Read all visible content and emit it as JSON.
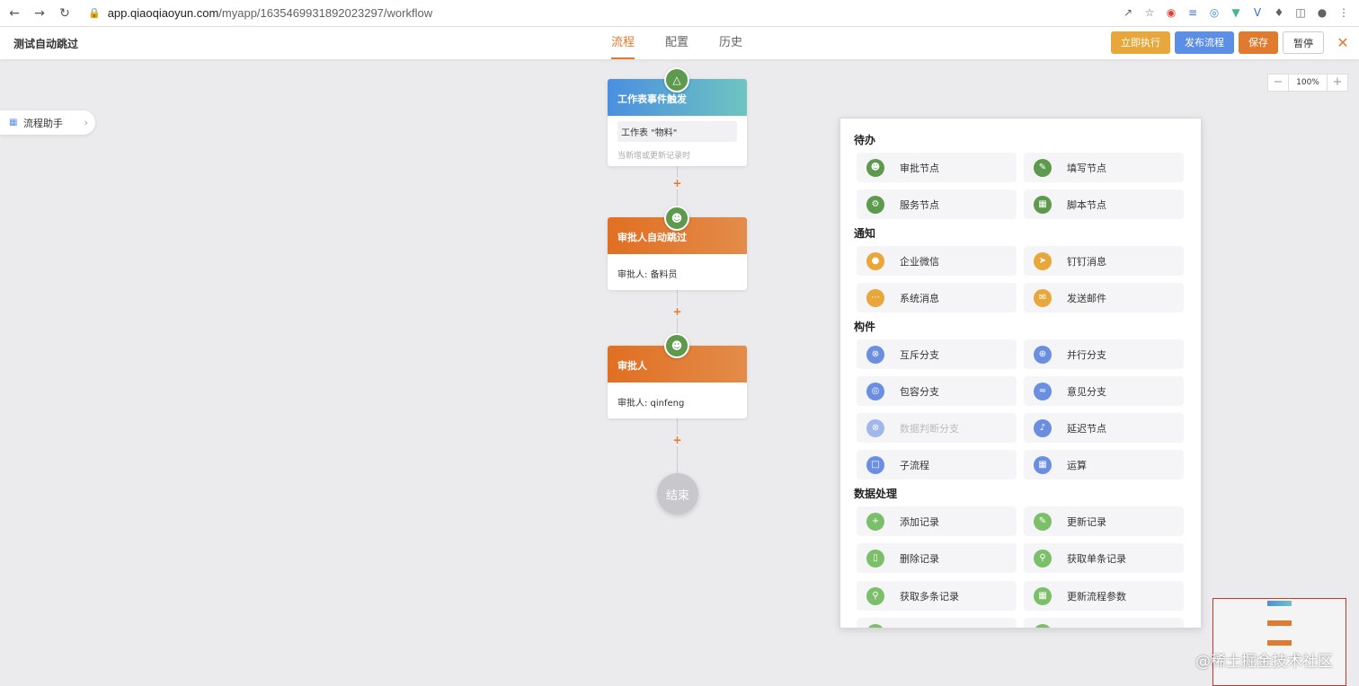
{
  "browser": {
    "url_host": "app.qiaoqiaoyun.com",
    "url_path": "/myapp/1635469931892023297/workflow"
  },
  "header": {
    "title": "测试自动跳过",
    "tabs": [
      {
        "label": "流程",
        "active": true
      },
      {
        "label": "配置",
        "active": false
      },
      {
        "label": "历史",
        "active": false
      }
    ],
    "run_label": "立即执行",
    "publish_label": "发布流程",
    "save_label": "保存",
    "pause_label": "暂停",
    "close_icon": "close-icon"
  },
  "helper": {
    "label": "流程助手"
  },
  "zoom": {
    "minus": "−",
    "value": "100%",
    "plus": "+"
  },
  "flow": {
    "trigger": {
      "title": "工作表事件触发",
      "table": "工作表 \"物料\"",
      "condition": "当新增或更新记录时"
    },
    "approver_auto": {
      "title": "审批人自动跳过",
      "detail": "审批人: 备料员"
    },
    "approver": {
      "title": "审批人",
      "detail": "审批人: qinfeng"
    },
    "end_label": "结束",
    "add_symbol": "+"
  },
  "panel": {
    "sections": [
      {
        "title": "待办",
        "items": [
          {
            "label": "审批节点",
            "icon": "user-icon",
            "color": "green"
          },
          {
            "label": "填写节点",
            "icon": "edit-icon",
            "color": "green"
          },
          {
            "label": "服务节点",
            "icon": "gear-icon",
            "color": "green"
          },
          {
            "label": "脚本节点",
            "icon": "script-icon",
            "color": "green"
          }
        ]
      },
      {
        "title": "通知",
        "items": [
          {
            "label": "企业微信",
            "icon": "wechat-icon",
            "color": "orange"
          },
          {
            "label": "钉钉消息",
            "icon": "dingtalk-icon",
            "color": "orange"
          },
          {
            "label": "系统消息",
            "icon": "message-icon",
            "color": "orange"
          },
          {
            "label": "发送邮件",
            "icon": "mail-icon",
            "color": "orange"
          }
        ]
      },
      {
        "title": "构件",
        "items": [
          {
            "label": "互斥分支",
            "icon": "exclusive-branch-icon",
            "color": "blue"
          },
          {
            "label": "并行分支",
            "icon": "parallel-branch-icon",
            "color": "blue"
          },
          {
            "label": "包容分支",
            "icon": "inclusive-branch-icon",
            "color": "blue"
          },
          {
            "label": "意见分支",
            "icon": "share-icon",
            "color": "blue"
          },
          {
            "label": "数据判断分支",
            "icon": "data-branch-icon",
            "color": "blue",
            "disabled": true
          },
          {
            "label": "延迟节点",
            "icon": "bell-icon",
            "color": "blue"
          },
          {
            "label": "子流程",
            "icon": "subprocess-icon",
            "color": "blue"
          },
          {
            "label": "运算",
            "icon": "calculator-icon",
            "color": "blue"
          }
        ]
      },
      {
        "title": "数据处理",
        "items": [
          {
            "label": "添加记录",
            "icon": "plus-icon",
            "color": "lightgreen"
          },
          {
            "label": "更新记录",
            "icon": "edit-icon",
            "color": "lightgreen"
          },
          {
            "label": "删除记录",
            "icon": "trash-icon",
            "color": "lightgreen"
          },
          {
            "label": "获取单条记录",
            "icon": "search-icon",
            "color": "lightgreen"
          },
          {
            "label": "获取多条记录",
            "icon": "search-multi-icon",
            "color": "lightgreen"
          },
          {
            "label": "更新流程参数",
            "icon": "params-icon",
            "color": "lightgreen"
          }
        ]
      }
    ]
  },
  "watermark": "@稀土掘金技术社区",
  "colors": {
    "accent": "#e07a2f",
    "publish": "#5b8ee6",
    "run": "#e8a73a",
    "green": "#5d9a4e"
  }
}
